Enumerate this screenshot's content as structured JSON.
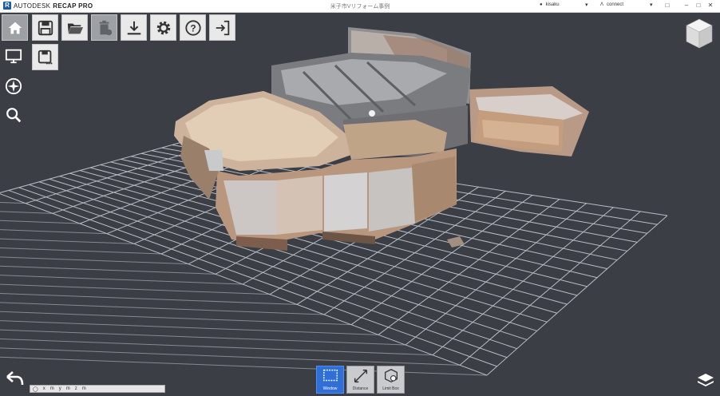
{
  "titlebar": {
    "brand": "AUTODESK",
    "product": "RECAP PRO",
    "title": "米子市Vリフォーム事例",
    "user": "kisaku",
    "connect": "connect"
  },
  "toolbar": {
    "items": [
      {
        "name": "home",
        "icon": "home-icon"
      },
      {
        "name": "save",
        "icon": "save-icon"
      },
      {
        "name": "open",
        "icon": "folder-open-icon"
      },
      {
        "name": "delete",
        "icon": "trash-icon"
      },
      {
        "name": "import",
        "icon": "download-icon"
      },
      {
        "name": "settings",
        "icon": "gear-icon"
      },
      {
        "name": "help",
        "icon": "help-icon"
      },
      {
        "name": "exit",
        "icon": "exit-icon"
      }
    ]
  },
  "bottom_tools": {
    "window": "Window",
    "distance": "Distance",
    "limit_box": "Limit Box"
  },
  "status": {
    "segments": [
      "x",
      "m",
      "y",
      "m",
      "z",
      "m"
    ]
  },
  "colors": {
    "viewport_bg": "#3b3e45",
    "grid": "#b8bcc4",
    "accent": "#2f6fd6"
  }
}
